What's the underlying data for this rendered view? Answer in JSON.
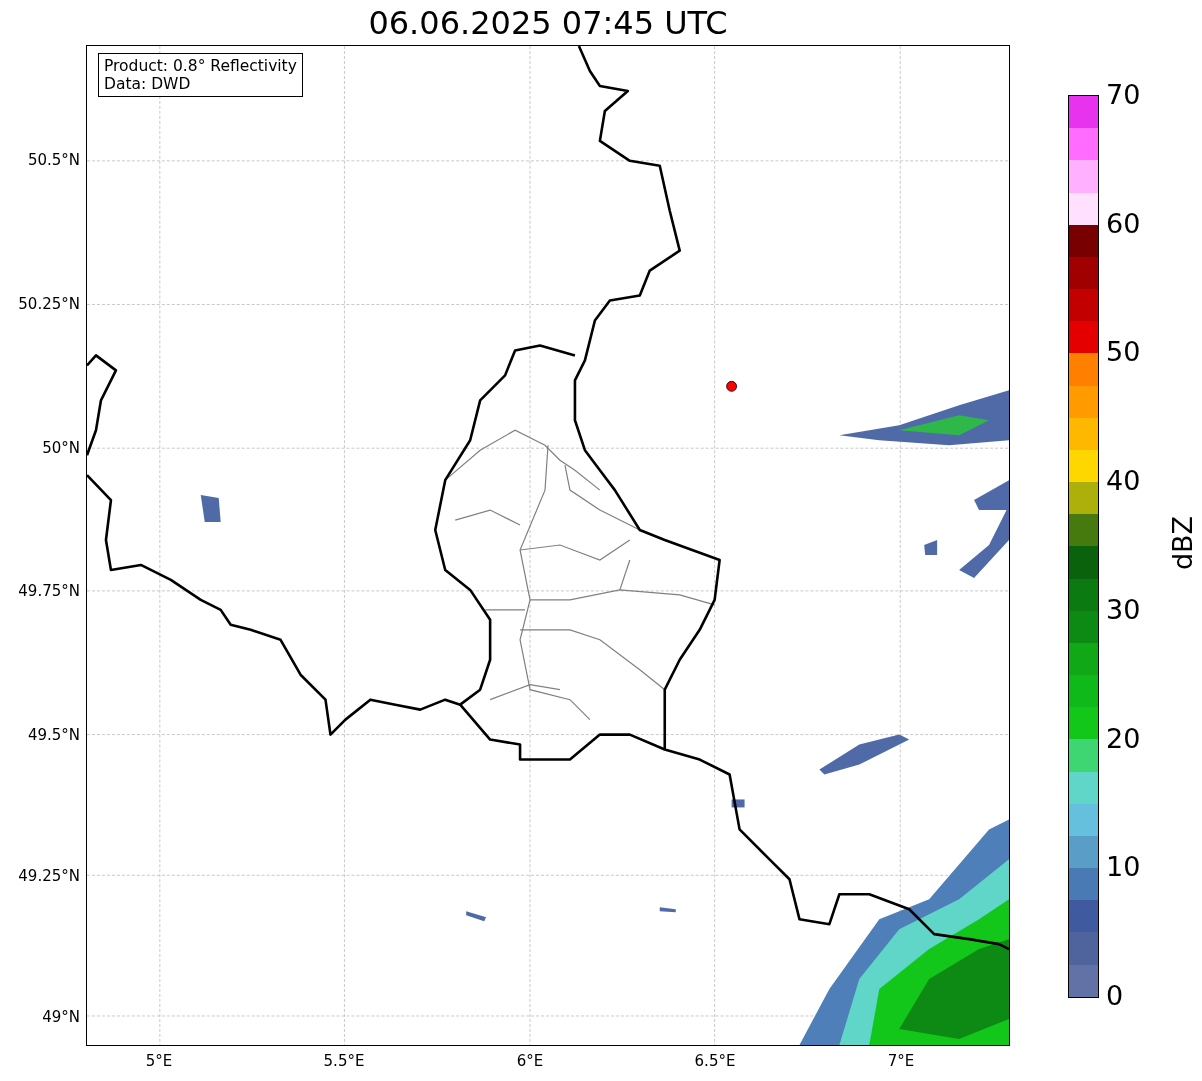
{
  "title": "06.06.2025 07:45 UTC",
  "info_box": [
    "Product: 0.8° Reflectivity",
    "Data: DWD"
  ],
  "map": {
    "y_ticks": [
      "50.5°N",
      "50.25°N",
      "50°N",
      "49.75°N",
      "49.5°N",
      "49.25°N",
      "49°N"
    ],
    "x_ticks": [
      "5°E",
      "5.5°E",
      "6°E",
      "6.5°E",
      "7°E"
    ]
  },
  "colorbar": {
    "label": "dBZ",
    "ticks": [
      "70",
      "60",
      "50",
      "40",
      "30",
      "20",
      "10",
      "0"
    ],
    "segments": [
      {
        "color": "#6372a6"
      },
      {
        "color": "#4f639d"
      },
      {
        "color": "#405aa0"
      },
      {
        "color": "#4a7ab3"
      },
      {
        "color": "#5a9ec8"
      },
      {
        "color": "#64c0dc"
      },
      {
        "color": "#5fd6c8"
      },
      {
        "color": "#3dd672"
      },
      {
        "color": "#12c71a"
      },
      {
        "color": "#10b91a"
      },
      {
        "color": "#10a817"
      },
      {
        "color": "#0d8a13"
      },
      {
        "color": "#0b7a10"
      },
      {
        "color": "#0a620c"
      },
      {
        "color": "#477a0e"
      },
      {
        "color": "#adb00a"
      },
      {
        "color": "#ffd700"
      },
      {
        "color": "#ffb800"
      },
      {
        "color": "#ff9a00"
      },
      {
        "color": "#ff7f00"
      },
      {
        "color": "#e40000"
      },
      {
        "color": "#c20000"
      },
      {
        "color": "#a00000"
      },
      {
        "color": "#780000"
      },
      {
        "color": "#ffe0ff"
      },
      {
        "color": "#ffb0ff"
      },
      {
        "color": "#ff6cff"
      },
      {
        "color": "#e833ee"
      }
    ]
  }
}
